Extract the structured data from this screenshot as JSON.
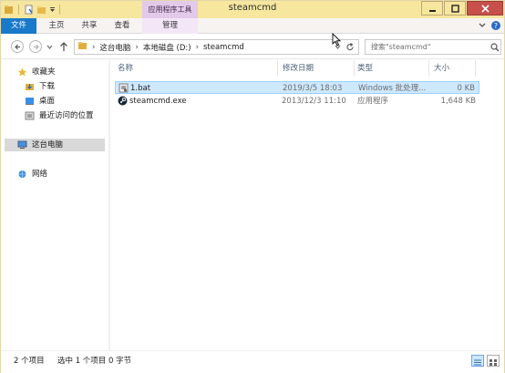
{
  "window": {
    "title": "steamcmd",
    "tool_group": "应用程序工具",
    "controls": [
      "minimize-icon",
      "maximize-icon",
      "close-icon"
    ],
    "accent": "#1979ca"
  },
  "ribbon": {
    "tabs": [
      "文件",
      "主页",
      "共享",
      "查看",
      "管理"
    ]
  },
  "address": {
    "segments": [
      "这台电脑",
      "本地磁盘 (D:)",
      "steamcmd"
    ]
  },
  "search": {
    "placeholder": "搜索\"steamcmd\""
  },
  "nav": {
    "favorites": "收藏夹",
    "downloads": "下载",
    "desktop": "桌面",
    "recent": "最近访问的位置",
    "this_pc": "这台电脑",
    "network": "网络"
  },
  "columns": [
    "名称",
    "修改日期",
    "类型",
    "大小"
  ],
  "files": [
    {
      "name": "1.bat",
      "date": "2019/3/5 18:03",
      "type": "Windows 批处理...",
      "size": "0 KB",
      "icon": "batch-file-icon",
      "selected": true
    },
    {
      "name": "steamcmd.exe",
      "date": "2013/12/3 11:10",
      "type": "应用程序",
      "size": "1,648 KB",
      "icon": "steam-icon",
      "selected": false
    }
  ],
  "status": {
    "count": "2 个项目",
    "selection": "选中 1 个项目 0 字节"
  }
}
